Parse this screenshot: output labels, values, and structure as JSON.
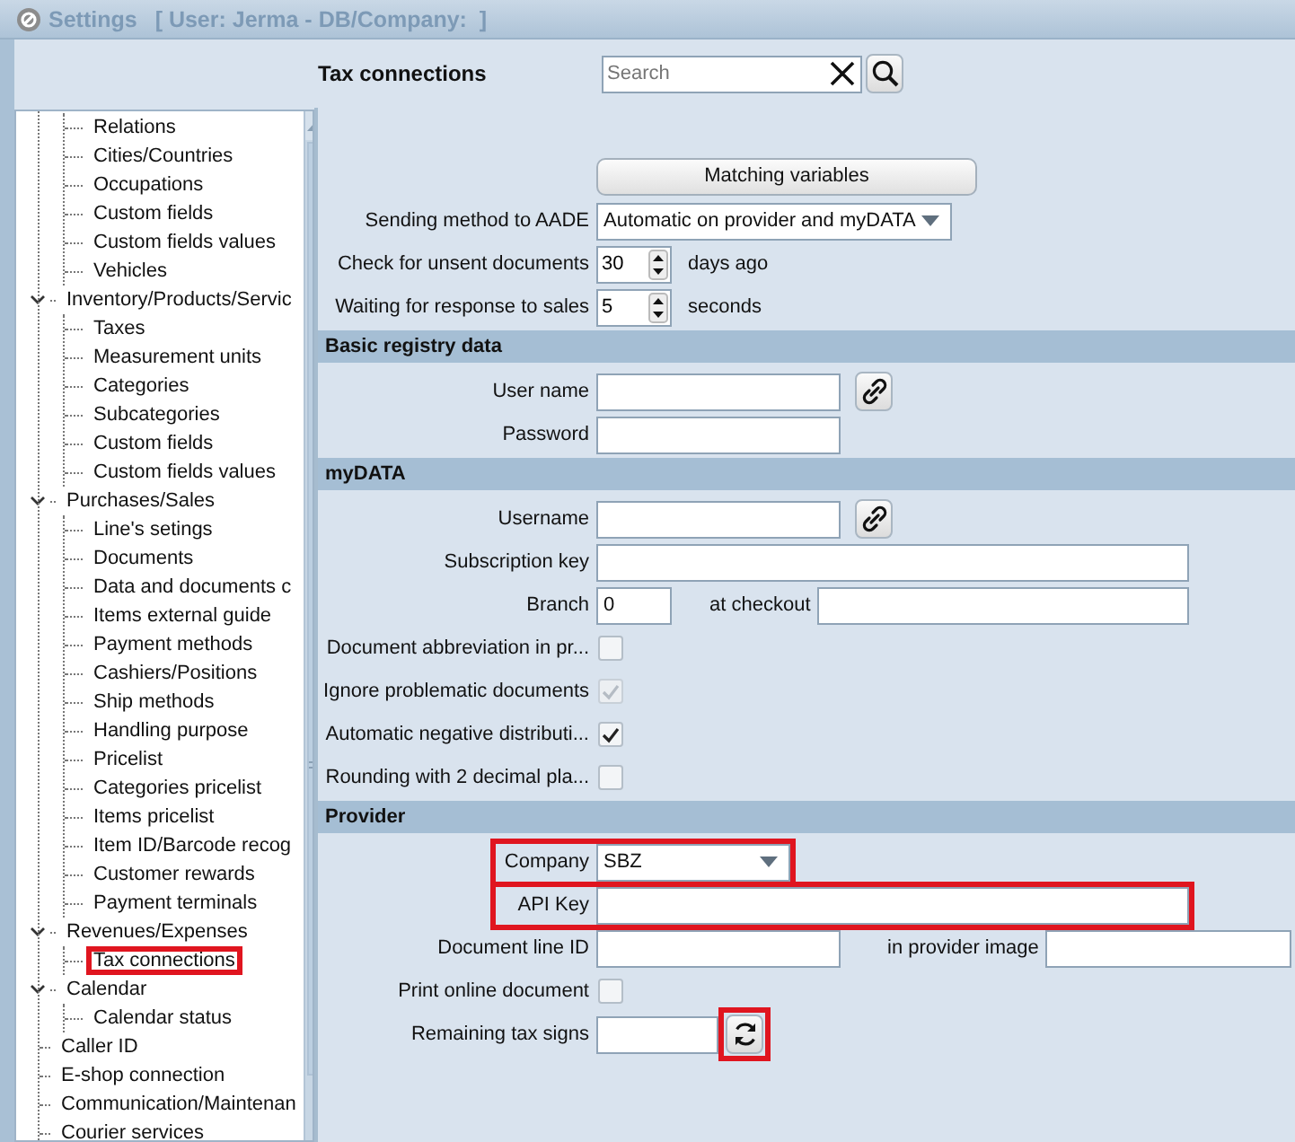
{
  "window": {
    "title": "Settings",
    "context": "[ User: Jerma - DB/Company:  ]"
  },
  "header": {
    "title": "Tax connections",
    "search": {
      "placeholder": "Search"
    }
  },
  "sidebar": {
    "tree": [
      {
        "children": [
          {
            "label": "Relations",
            "selected": false
          },
          {
            "label": "Cities/Countries",
            "selected": false
          },
          {
            "label": "Occupations",
            "selected": false
          },
          {
            "label": "Custom fields",
            "selected": false
          },
          {
            "label": "Custom fields values",
            "selected": false
          },
          {
            "label": "Vehicles",
            "selected": false
          }
        ]
      },
      {
        "label": "Inventory/Products/Servic",
        "selected": false,
        "expanded": true,
        "children": [
          {
            "label": "Taxes",
            "selected": false
          },
          {
            "label": "Measurement units",
            "selected": false
          },
          {
            "label": "Categories",
            "selected": false
          },
          {
            "label": "Subcategories",
            "selected": false
          },
          {
            "label": "Custom fields",
            "selected": false
          },
          {
            "label": "Custom fields values",
            "selected": false
          }
        ]
      },
      {
        "label": "Purchases/Sales",
        "selected": false,
        "expanded": true,
        "children": [
          {
            "label": "Line's setings",
            "selected": false
          },
          {
            "label": "Documents",
            "selected": false
          },
          {
            "label": "Data and documents c",
            "selected": false
          },
          {
            "label": "Items external guide",
            "selected": false
          },
          {
            "label": "Payment methods",
            "selected": false
          },
          {
            "label": "Cashiers/Positions",
            "selected": false
          },
          {
            "label": "Ship methods",
            "selected": false
          },
          {
            "label": "Handling purpose",
            "selected": false
          },
          {
            "label": "Pricelist",
            "selected": false
          },
          {
            "label": "Categories pricelist",
            "selected": false
          },
          {
            "label": "Items pricelist",
            "selected": false
          },
          {
            "label": "Item ID/Barcode recog",
            "selected": false
          },
          {
            "label": "Customer rewards",
            "selected": false
          },
          {
            "label": "Payment terminals",
            "selected": false
          }
        ]
      },
      {
        "label": "Revenues/Expenses",
        "selected": false,
        "expanded": true,
        "children": [
          {
            "label": "Tax connections",
            "selected": true
          }
        ]
      },
      {
        "label": "Calendar",
        "selected": false,
        "expanded": true,
        "children": [
          {
            "label": "Calendar status",
            "selected": false
          }
        ]
      },
      {
        "label": "Caller ID",
        "selected": false
      },
      {
        "label": "E-shop connection",
        "selected": false
      },
      {
        "label": "Communication/Maintenan",
        "selected": false
      },
      {
        "label": "Courier services",
        "selected": false
      }
    ]
  },
  "form": {
    "rows": [
      {
        "kind": "button",
        "label": "Matching variables"
      },
      {
        "kind": "select_wide",
        "label": "Sending method to AADE",
        "value": "Automatic on provider and myDATA"
      },
      {
        "kind": "spin",
        "label": "Check for unsent documents",
        "value": "30",
        "unit": "days ago"
      },
      {
        "kind": "spin",
        "label": "Waiting for response to sales",
        "value": "5",
        "unit": "seconds"
      },
      {
        "kind": "section",
        "label": "Basic registry data"
      },
      {
        "kind": "field_link",
        "label": "User name"
      },
      {
        "kind": "field",
        "label": "Password"
      },
      {
        "kind": "section",
        "label": "myDATA"
      },
      {
        "kind": "field_link",
        "label": "Username"
      },
      {
        "kind": "field_wide",
        "label": "Subscription key"
      },
      {
        "kind": "branch",
        "label": "Branch",
        "value": "0",
        "second_label": "at checkout"
      },
      {
        "kind": "checkbox",
        "label": "Document abbreviation in pr...",
        "checked": false,
        "disabled": false
      },
      {
        "kind": "checkbox",
        "label": "Ignore problematic documents",
        "checked": true,
        "disabled": true
      },
      {
        "kind": "checkbox",
        "label": "Automatic negative distributi...",
        "checked": true,
        "disabled": false
      },
      {
        "kind": "checkbox",
        "label": "Rounding with 2 decimal pla...",
        "checked": false,
        "disabled": false
      },
      {
        "kind": "section",
        "label": "Provider"
      },
      {
        "kind": "select",
        "label": "Company",
        "value": "SBZ",
        "highlighted": true
      },
      {
        "kind": "field_wide",
        "label": "API Key",
        "highlighted": true
      },
      {
        "kind": "field_pair",
        "label": "Document line ID",
        "second_label": "in provider image"
      },
      {
        "kind": "checkbox",
        "label": "Print online document",
        "checked": false,
        "disabled": false
      },
      {
        "kind": "field_refresh",
        "label": "Remaining tax signs",
        "highlighted": true
      }
    ]
  }
}
